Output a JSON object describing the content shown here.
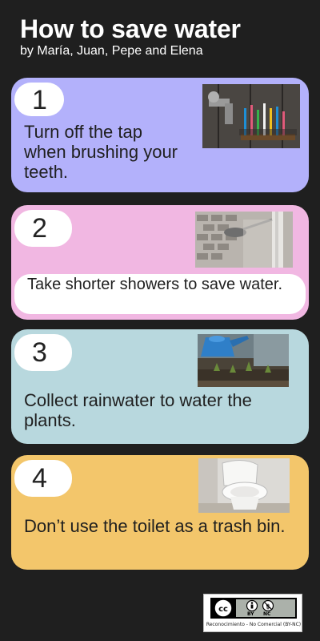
{
  "header": {
    "title": "How to save water",
    "subtitle": "by María, Juan, Pepe and Elena"
  },
  "cards": [
    {
      "number": "1",
      "text": "Turn off the tap when brushing your teeth.",
      "color": "#b3b1fb",
      "photo": "toothbrushes-tap-photo"
    },
    {
      "number": "2",
      "text": "Take shorter showers to save water.",
      "color": "#f1b7e2",
      "photo": "shower-head-photo"
    },
    {
      "number": "3",
      "text": "Collect rainwater to water the plants.",
      "color": "#b8d8de",
      "photo": "watering-can-photo"
    },
    {
      "number": "4",
      "text": "Don’t use the toilet as a trash bin.",
      "color": "#f3c66b",
      "photo": "toilet-photo"
    }
  ],
  "license": {
    "badge": "cc-by-nc-icon",
    "by_label": "BY",
    "nc_label": "NC",
    "caption": "Reconocimiento - No Comercial (BY-NC)"
  }
}
